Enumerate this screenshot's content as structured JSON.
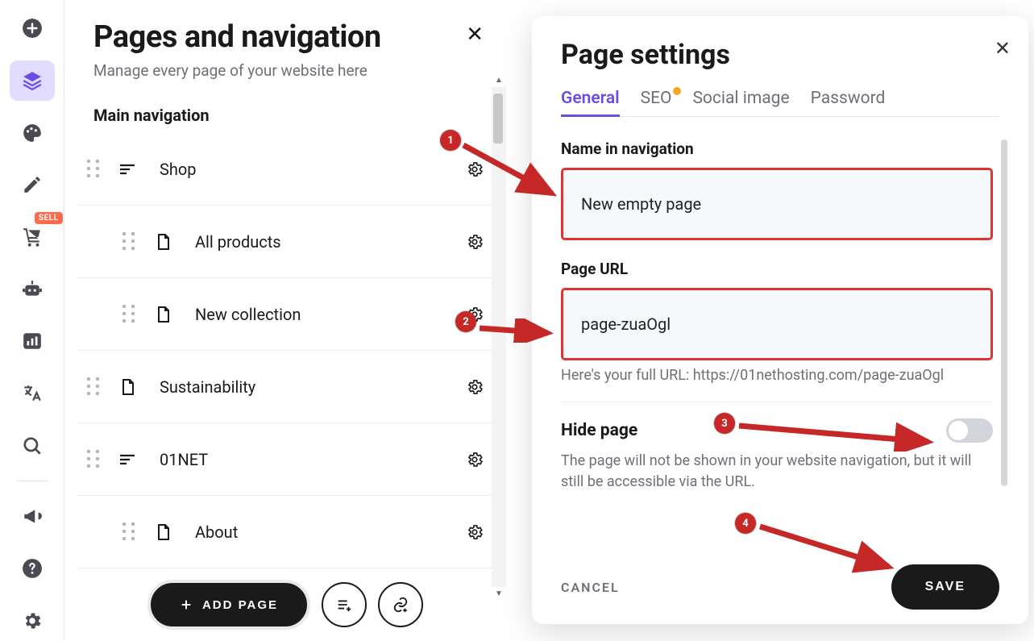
{
  "rail": {
    "sell_badge": "SELL"
  },
  "panel": {
    "title": "Pages and navigation",
    "subtitle": "Manage every page of your website here",
    "section": "Main navigation",
    "items": [
      {
        "label": "Shop",
        "icon": "menu",
        "child": false
      },
      {
        "label": "All products",
        "icon": "page",
        "child": true
      },
      {
        "label": "New collection",
        "icon": "page",
        "child": true
      },
      {
        "label": "Sustainability",
        "icon": "page",
        "child": false
      },
      {
        "label": "01NET",
        "icon": "menu",
        "child": false
      },
      {
        "label": "About",
        "icon": "page",
        "child": true
      }
    ],
    "add_page": "ADD PAGE"
  },
  "settings": {
    "title": "Page settings",
    "tabs": [
      "General",
      "SEO",
      "Social image",
      "Password"
    ],
    "active_tab": 0,
    "name_label": "Name in navigation",
    "name_value": "New empty page",
    "url_label": "Page URL",
    "url_value": "page-zuaOgl",
    "url_hint": "Here's your full URL: https://01nethosting.com/page-zuaOgl",
    "hide_label": "Hide page",
    "hide_desc": "The page will not be shown in your website navigation, but it will still be accessible via the URL.",
    "cancel": "CANCEL",
    "save": "SAVE"
  },
  "annotations": {
    "n1": "1",
    "n2": "2",
    "n3": "3",
    "n4": "4"
  }
}
